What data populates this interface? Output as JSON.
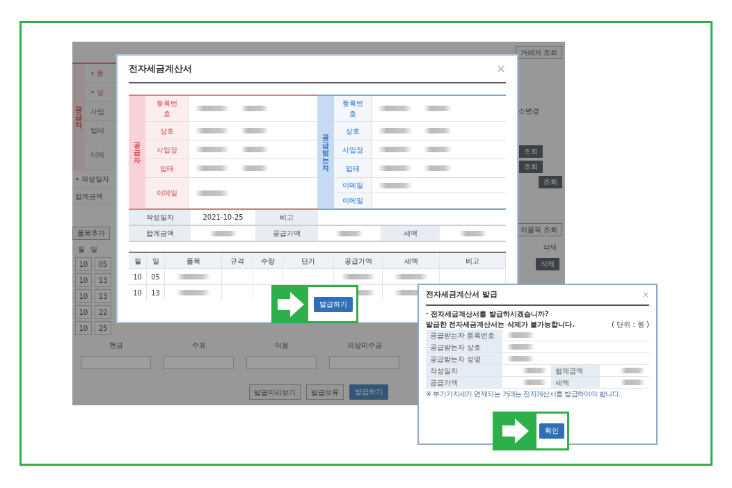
{
  "background_app": {
    "top_button": "거래처 조회",
    "supplier_strip": {
      "side_label": "공급자",
      "labels": [
        "• 등",
        "• 상",
        "사업",
        "업태",
        "이메"
      ]
    },
    "address_label": "소변경",
    "lookup_buttons": [
      "조회",
      "조회",
      "조회"
    ],
    "date_labels": [
      "• 작성일자",
      "합계금액"
    ],
    "add_item_button": "품목추가",
    "item_lookup_button": "처품목 조회",
    "item_columns": [
      "월",
      "일"
    ],
    "item_rows": [
      [
        "10",
        "05"
      ],
      [
        "10",
        "13"
      ],
      [
        "10",
        "13"
      ],
      [
        "10",
        "22"
      ],
      [
        "10",
        "25"
      ]
    ],
    "delete_column": "삭제",
    "delete_buttons": [
      "삭제"
    ],
    "payment_columns": [
      "현금",
      "수표",
      "어음",
      "외상미수금"
    ],
    "footer_buttons": [
      {
        "label": "발급미리보기",
        "primary": false
      },
      {
        "label": "발급보류",
        "primary": false
      },
      {
        "label": "발급하기",
        "primary": true
      }
    ]
  },
  "invoice_modal": {
    "title": "전자세금계산서",
    "close": "×",
    "parties": [
      {
        "kind": "supplier",
        "side_label": "공급자",
        "fields": [
          "등록번호",
          "상호",
          "사업장",
          "업태",
          "이메일"
        ]
      },
      {
        "kind": "receiver",
        "side_label": "공급받는자",
        "fields": [
          "등록번호",
          "상호",
          "사업장",
          "업태",
          "이메일",
          "이메일"
        ]
      }
    ],
    "summary_rows": [
      [
        {
          "label": "작성일자",
          "value": "2021-10-25"
        },
        {
          "label": "비고"
        }
      ],
      [
        {
          "label": "합계금액",
          "blurred": true
        },
        {
          "label": "공급가액",
          "blurred": true
        },
        {
          "label": "세액",
          "blurred": true
        }
      ]
    ],
    "item_columns": [
      "월",
      "일",
      "품목",
      "규격",
      "수량",
      "단가",
      "공급가액",
      "세액",
      "비고"
    ],
    "item_rows": [
      [
        "10",
        "05"
      ],
      [
        "10",
        "13"
      ]
    ],
    "issue_button": "발급하기"
  },
  "confirm_modal": {
    "title": "전자세금계산서 발급",
    "close": "×",
    "question": "· 전자세금계산서를 발급하시겠습니까?",
    "warning": "발급한 전자세금계산서는 삭제가 불가능합니다.",
    "unit": "( 단위 : 원 )",
    "rows": [
      [
        "공급받는자 등록번호"
      ],
      [
        "공급받는자 상호"
      ],
      [
        "공급받는자 성명"
      ],
      [
        "작성일자",
        "합계금액"
      ],
      [
        "공급가액",
        "세액"
      ]
    ],
    "note": "※ 부가가치세가 면제되는 거래는 전자계산서를 발급하여야 합니다.",
    "confirm_button": "확인"
  }
}
